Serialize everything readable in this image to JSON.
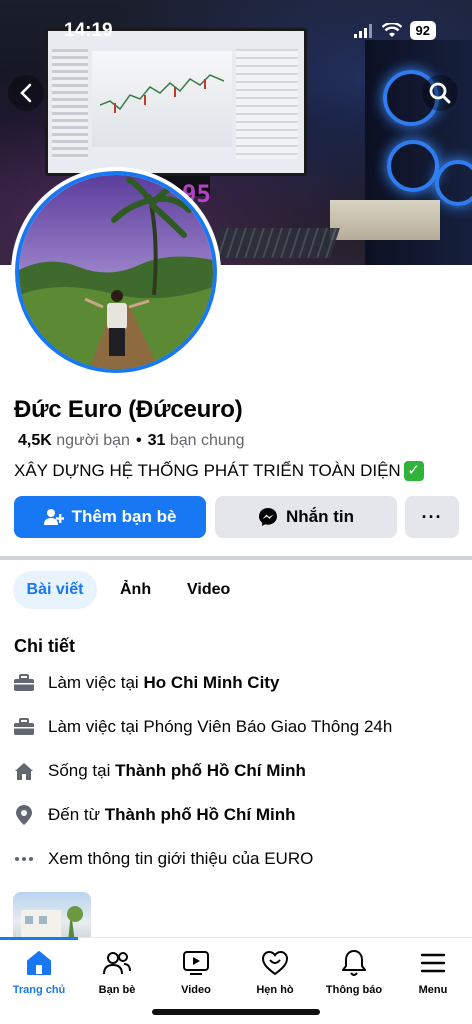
{
  "status_bar": {
    "time": "14:19",
    "battery": "92"
  },
  "profile": {
    "name": "Đức Euro (Đứceuro)",
    "friends_count": "4,5K",
    "friends_label": "người bạn",
    "separator": "•",
    "mutual_count": "31",
    "mutual_label": "bạn chung",
    "bio": "XÂY DỰNG HỆ THỐNG PHÁT TRIỂN TOÀN DIỆN"
  },
  "actions": {
    "add_friend": "Thêm bạn bè",
    "message": "Nhắn tin",
    "more": "···"
  },
  "tabs": [
    {
      "label": "Bài viết",
      "active": true
    },
    {
      "label": "Ảnh",
      "active": false
    },
    {
      "label": "Video",
      "active": false
    }
  ],
  "details": {
    "title": "Chi tiết",
    "items": [
      {
        "icon": "briefcase-icon",
        "prefix": "Làm việc tại ",
        "bold": "Ho Chi Minh City"
      },
      {
        "icon": "briefcase-icon",
        "prefix": "Làm việc tại Phóng Viên Báo Giao Thông 24h",
        "bold": ""
      },
      {
        "icon": "home-icon",
        "prefix": "Sống tại ",
        "bold": "Thành phố Hồ Chí Minh"
      },
      {
        "icon": "location-pin-icon",
        "prefix": "Đến từ ",
        "bold": "Thành phố Hồ Chí Minh"
      },
      {
        "icon": "more-dots-icon",
        "prefix": "Xem thông tin giới thiệu của EURO",
        "bold": ""
      }
    ]
  },
  "bottom_nav": [
    {
      "label": "Trang chủ",
      "icon": "home-icon",
      "active": true
    },
    {
      "label": "Bạn bè",
      "icon": "friends-icon",
      "active": false
    },
    {
      "label": "Video",
      "icon": "video-icon",
      "active": false
    },
    {
      "label": "Hẹn hò",
      "icon": "dating-heart-icon",
      "active": false
    },
    {
      "label": "Thông báo",
      "icon": "bell-icon",
      "active": false
    },
    {
      "label": "Menu",
      "icon": "menu-icon",
      "active": false
    }
  ],
  "colors": {
    "brand": "#1877f2",
    "secondary_bg": "#e4e6eb",
    "muted_text": "#65676b"
  }
}
